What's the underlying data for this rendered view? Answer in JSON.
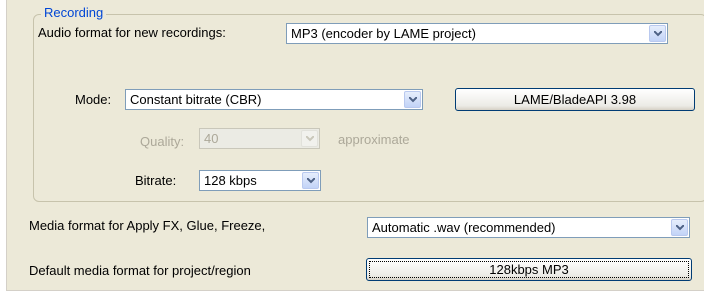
{
  "recording": {
    "group_title": "Recording",
    "audio_format_label": "Audio format for new recordings:",
    "audio_format_value": "MP3 (encoder by LAME project)",
    "mode_label": "Mode:",
    "mode_value": "Constant bitrate  (CBR)",
    "encoder_button_label": "LAME/BladeAPI 3.98",
    "quality_label": "Quality:",
    "quality_value": "40",
    "quality_suffix": "approximate",
    "bitrate_label": "Bitrate:",
    "bitrate_value": "128 kbps"
  },
  "media": {
    "apply_fx_label": "Media format for Apply FX, Glue, Freeze,",
    "apply_fx_value": "Automatic .wav (recommended)",
    "default_format_label": "Default media format for project/region",
    "default_format_button_label": "128kbps MP3"
  },
  "icons": {
    "dropdown_arrow": "chevron-down-icon"
  },
  "colors": {
    "panel_bg": "#ece9d8",
    "group_title": "#0046d5",
    "input_border": "#7f9db9",
    "disabled_text": "#aca899"
  }
}
